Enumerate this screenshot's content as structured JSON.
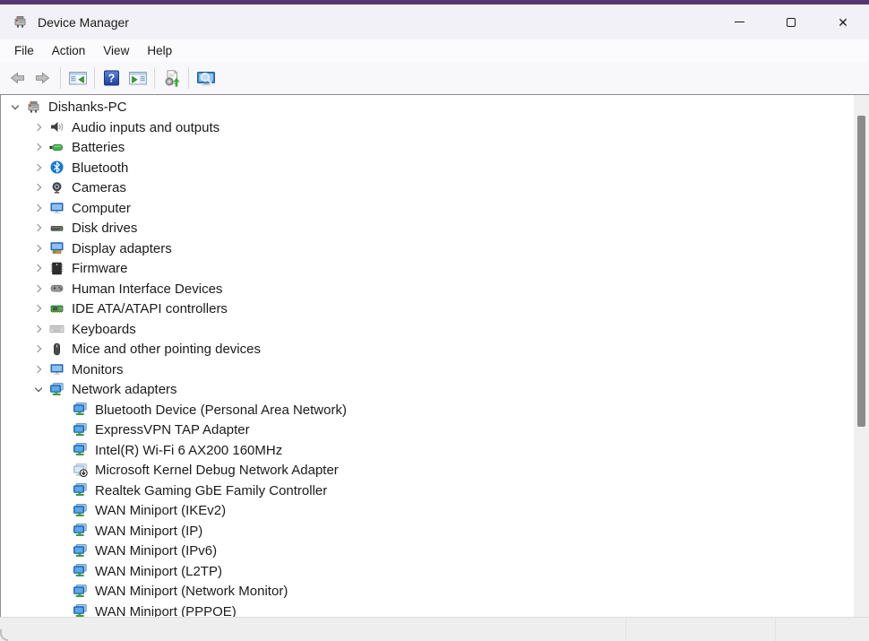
{
  "titlebar": {
    "title": "Device Manager"
  },
  "window_controls": [
    {
      "name": "minimize",
      "icon": "minimize-icon"
    },
    {
      "name": "maximize",
      "icon": "maximize-icon"
    },
    {
      "name": "close",
      "icon": "close-icon"
    }
  ],
  "menubar": {
    "items": [
      {
        "label": "File"
      },
      {
        "label": "Action"
      },
      {
        "label": "View"
      },
      {
        "label": "Help"
      }
    ]
  },
  "toolbar": {
    "buttons": [
      {
        "type": "button",
        "name": "back",
        "icon": "back-arrow",
        "disabled": true
      },
      {
        "type": "button",
        "name": "forward",
        "icon": "forward-arrow",
        "disabled": true
      },
      {
        "type": "sep"
      },
      {
        "type": "button",
        "name": "show-console-tree",
        "icon": "console-tree"
      },
      {
        "type": "sep"
      },
      {
        "type": "button",
        "name": "help",
        "icon": "help"
      },
      {
        "type": "button",
        "name": "show-action-pane",
        "icon": "action-pane"
      },
      {
        "type": "sep"
      },
      {
        "type": "button",
        "name": "scan-for-hardware-changes",
        "icon": "scan-hardware"
      },
      {
        "type": "sep"
      },
      {
        "type": "button",
        "name": "device-properties",
        "icon": "search-monitor"
      }
    ]
  },
  "tree": {
    "items": [
      {
        "label": "Dishanks-PC",
        "icon": "computer-system",
        "level": 0,
        "state": "expanded"
      },
      {
        "label": "Audio inputs and outputs",
        "icon": "audio",
        "level": 1,
        "state": "collapsed"
      },
      {
        "label": "Batteries",
        "icon": "battery",
        "level": 1,
        "state": "collapsed"
      },
      {
        "label": "Bluetooth",
        "icon": "bluetooth",
        "level": 1,
        "state": "collapsed"
      },
      {
        "label": "Cameras",
        "icon": "camera",
        "level": 1,
        "state": "collapsed"
      },
      {
        "label": "Computer",
        "icon": "computer",
        "level": 1,
        "state": "collapsed"
      },
      {
        "label": "Disk drives",
        "icon": "disk",
        "level": 1,
        "state": "collapsed"
      },
      {
        "label": "Display adapters",
        "icon": "display",
        "level": 1,
        "state": "collapsed"
      },
      {
        "label": "Firmware",
        "icon": "firmware",
        "level": 1,
        "state": "collapsed"
      },
      {
        "label": "Human Interface Devices",
        "icon": "hid",
        "level": 1,
        "state": "collapsed"
      },
      {
        "label": "IDE ATA/ATAPI controllers",
        "icon": "ide",
        "level": 1,
        "state": "collapsed"
      },
      {
        "label": "Keyboards",
        "icon": "keyboard",
        "level": 1,
        "state": "collapsed"
      },
      {
        "label": "Mice and other pointing devices",
        "icon": "mouse",
        "level": 1,
        "state": "collapsed"
      },
      {
        "label": "Monitors",
        "icon": "monitor",
        "level": 1,
        "state": "collapsed"
      },
      {
        "label": "Network adapters",
        "icon": "network",
        "level": 1,
        "state": "expanded"
      },
      {
        "label": "Bluetooth Device (Personal Area Network)",
        "icon": "network",
        "level": 2,
        "state": "none"
      },
      {
        "label": "ExpressVPN TAP Adapter",
        "icon": "network",
        "level": 2,
        "state": "none"
      },
      {
        "label": "Intel(R) Wi-Fi 6 AX200 160MHz",
        "icon": "network",
        "level": 2,
        "state": "none"
      },
      {
        "label": "Microsoft Kernel Debug Network Adapter",
        "icon": "network-disabled",
        "level": 2,
        "state": "none"
      },
      {
        "label": "Realtek Gaming GbE Family Controller",
        "icon": "network",
        "level": 2,
        "state": "none"
      },
      {
        "label": "WAN Miniport (IKEv2)",
        "icon": "network",
        "level": 2,
        "state": "none"
      },
      {
        "label": "WAN Miniport (IP)",
        "icon": "network",
        "level": 2,
        "state": "none"
      },
      {
        "label": "WAN Miniport (IPv6)",
        "icon": "network",
        "level": 2,
        "state": "none"
      },
      {
        "label": "WAN Miniport (L2TP)",
        "icon": "network",
        "level": 2,
        "state": "none"
      },
      {
        "label": "WAN Miniport (Network Monitor)",
        "icon": "network",
        "level": 2,
        "state": "none"
      },
      {
        "label": "WAN Miniport (PPPOE)",
        "icon": "network",
        "level": 2,
        "state": "none"
      }
    ]
  },
  "colors": {
    "accent_strip": "#543673",
    "bluetooth_blue": "#1177d6",
    "network_blue": "#2f86d8",
    "network_green": "#46b04c",
    "scroll_thumb": "#8b8b8b"
  }
}
